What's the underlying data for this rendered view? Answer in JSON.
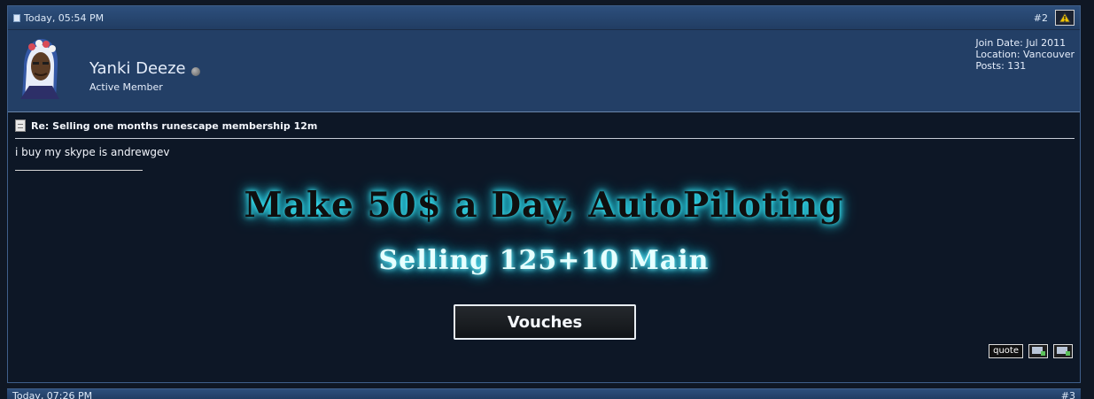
{
  "post": {
    "date": "Today, 05:54 PM",
    "number": "#2",
    "username": "Yanki Deeze",
    "user_title": "Active Member",
    "info": {
      "join_date": "Join Date: Jul 2011",
      "location": "Location: Vancouver",
      "posts": "Posts: 131"
    },
    "title": "Re: Selling one months runescape membership 12m",
    "message": "i buy my skype is andrewgev",
    "signature": {
      "banner_line1": "Make 50$ a Day, AutoPiloting",
      "banner_line2": "Selling 125+10 Main",
      "vouches_button": "Vouches"
    },
    "actions": {
      "quote": "quote"
    }
  },
  "next_post": {
    "date": "Today, 07:26 PM",
    "number": "#3"
  },
  "colors": {
    "header_blue": "#2d4f7c",
    "user_row_blue": "#233f66",
    "content_bg": "#0d1726",
    "banner_glow": "#2be6ff"
  },
  "icons": {
    "post_icon": "document-icon",
    "warning": "warning-icon",
    "status": "offline-dot-icon",
    "multiquote": "multiquote-icon",
    "reply": "reply-icon"
  }
}
